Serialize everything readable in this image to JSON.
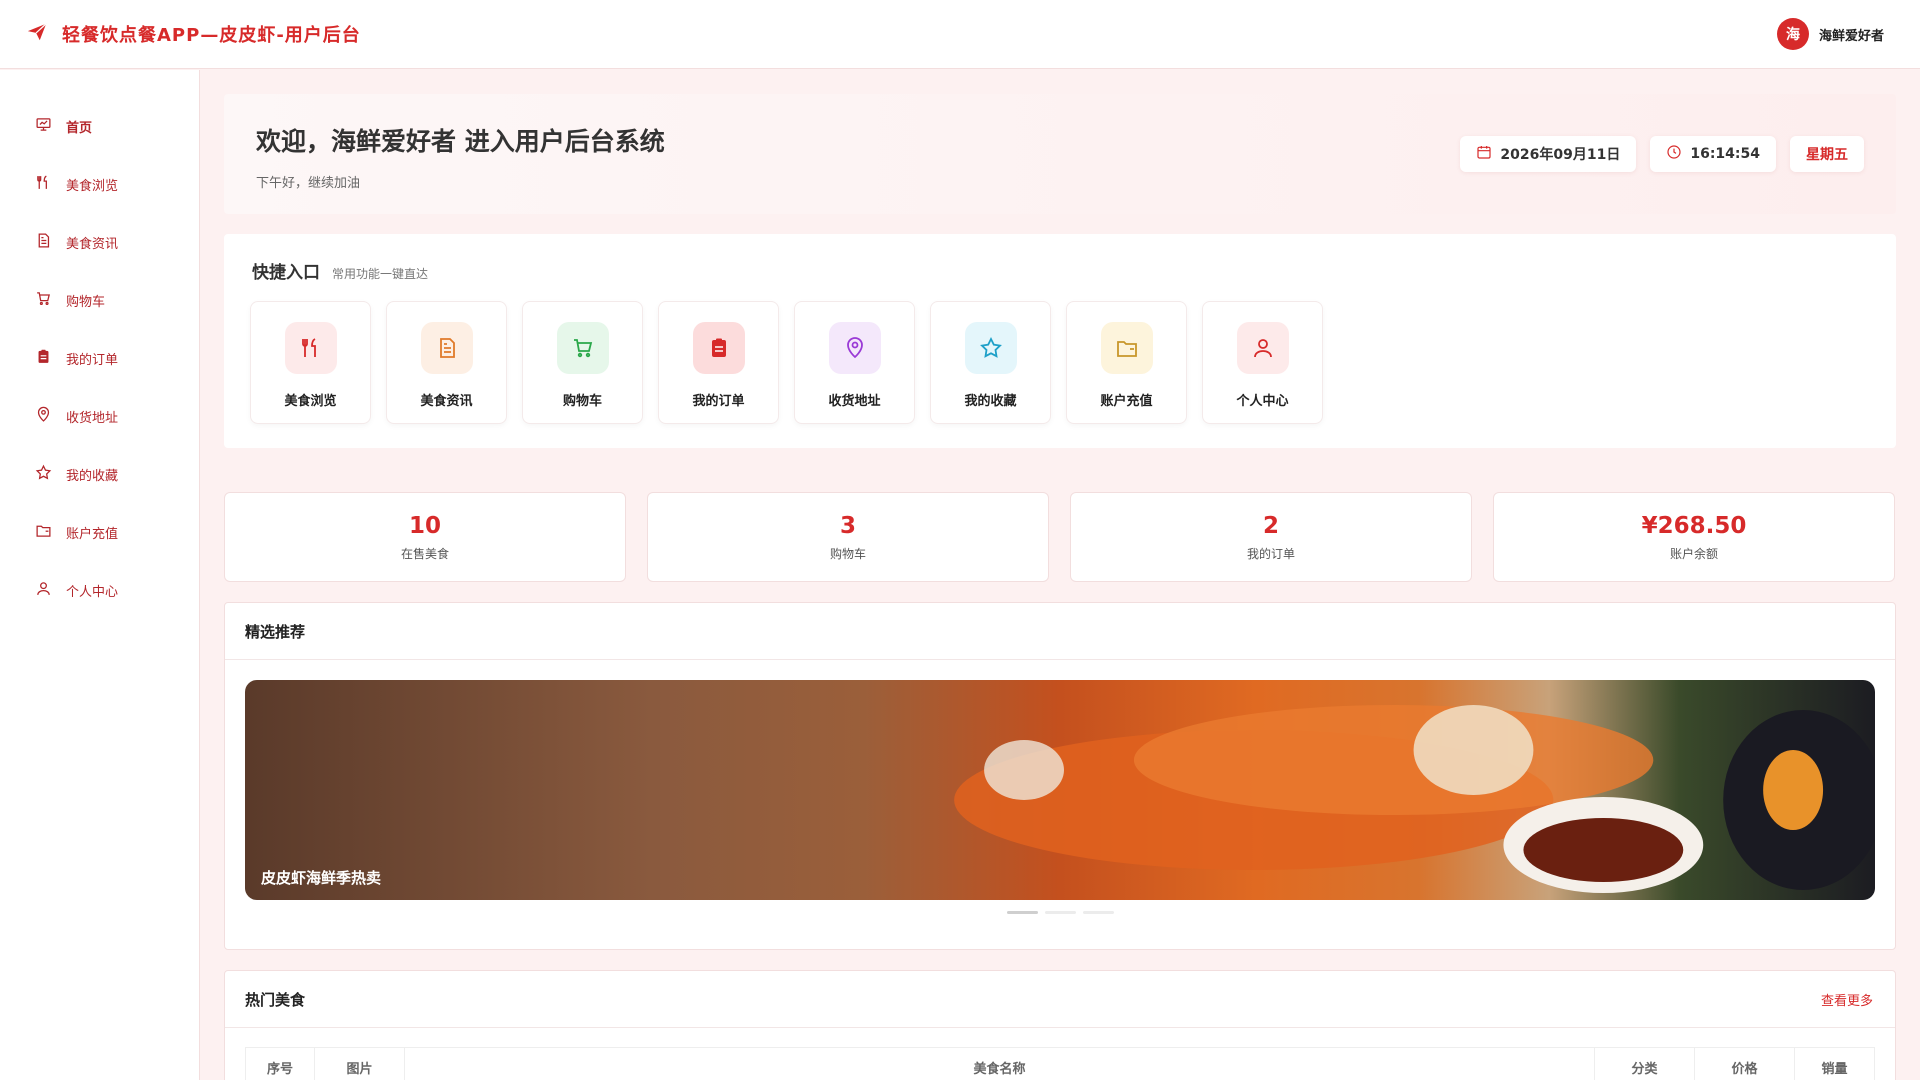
{
  "header": {
    "app_title": "轻餐饮点餐APP—皮皮虾-用户后台",
    "avatar_text": "海",
    "user_name": "海鲜爱好者"
  },
  "sidebar": {
    "items": [
      {
        "label": "首页",
        "icon": "presentation-icon",
        "active": true
      },
      {
        "label": "美食浏览",
        "icon": "utensils-icon"
      },
      {
        "label": "美食资讯",
        "icon": "document-icon"
      },
      {
        "label": "购物车",
        "icon": "cart-icon"
      },
      {
        "label": "我的订单",
        "icon": "clipboard-icon"
      },
      {
        "label": "收货地址",
        "icon": "location-icon"
      },
      {
        "label": "我的收藏",
        "icon": "star-icon"
      },
      {
        "label": "账户充值",
        "icon": "wallet-icon"
      },
      {
        "label": "个人中心",
        "icon": "user-icon"
      }
    ]
  },
  "welcome": {
    "title": "欢迎，海鲜爱好者 进入用户后台系统",
    "subtitle": "下午好，继续加油",
    "date": "2026年09月11日",
    "time": "16:14:54",
    "weekday": "星期五"
  },
  "quick": {
    "title": "快捷入口",
    "subtitle": "常用功能一键直达",
    "items": [
      {
        "label": "美食浏览",
        "icon": "utensils-icon",
        "bg": "#fdeaea",
        "color": "#d72a2a"
      },
      {
        "label": "美食资讯",
        "icon": "document-icon",
        "bg": "#fdefe4",
        "color": "#e07a2a"
      },
      {
        "label": "购物车",
        "icon": "cart-icon",
        "bg": "#e6f7ea",
        "color": "#2aa84a"
      },
      {
        "label": "我的订单",
        "icon": "clipboard-icon",
        "bg": "#fcdcdc",
        "color": "#d72a2a"
      },
      {
        "label": "收货地址",
        "icon": "location-icon",
        "bg": "#f4e8fb",
        "color": "#9a3ad6"
      },
      {
        "label": "我的收藏",
        "icon": "star-icon",
        "bg": "#e4f6fb",
        "color": "#1ea0c8"
      },
      {
        "label": "账户充值",
        "icon": "wallet-icon",
        "bg": "#fdf4dc",
        "color": "#c8962a"
      },
      {
        "label": "个人中心",
        "icon": "user-icon",
        "bg": "#fdeaea",
        "color": "#d72a2a"
      }
    ]
  },
  "stats": [
    {
      "value": "10",
      "label": "在售美食"
    },
    {
      "value": "3",
      "label": "购物车"
    },
    {
      "value": "2",
      "label": "我的订单"
    },
    {
      "value": "¥268.50",
      "label": "账户余额"
    }
  ],
  "featured": {
    "title": "精选推荐",
    "banner_caption": "皮皮虾海鲜季热卖",
    "slide_count": 3,
    "active_slide": 0
  },
  "hot": {
    "title": "热门美食",
    "more": "查看更多",
    "columns": [
      "序号",
      "图片",
      "美食名称",
      "分类",
      "价格",
      "销量"
    ]
  },
  "colors": {
    "accent": "#d72a2a",
    "background": "#fdf1f1"
  }
}
